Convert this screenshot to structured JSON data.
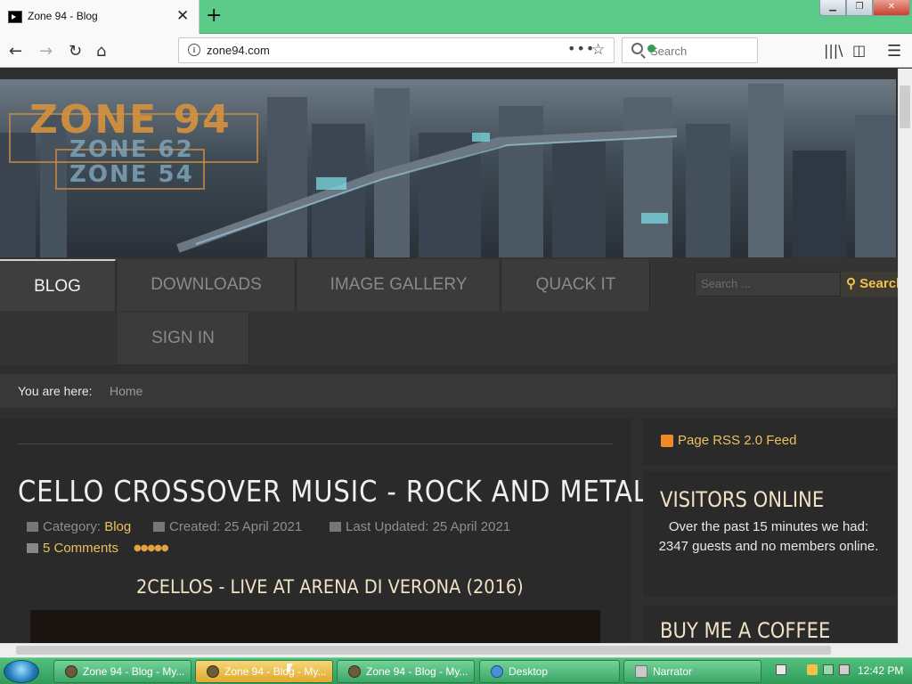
{
  "browser": {
    "tab_title": "Zone 94 - Blog",
    "url": "zone94.com",
    "search_placeholder": "Search"
  },
  "site": {
    "logo_main": "ZONE 94",
    "logo_sub_1": "ZONE 62",
    "logo_sub_2": "ZONE 54",
    "menu": [
      {
        "label": "BLOG",
        "active": true
      },
      {
        "label": "DOWNLOADS",
        "active": false
      },
      {
        "label": "IMAGE GALLERY",
        "active": false
      },
      {
        "label": "QUACK IT",
        "active": false
      },
      {
        "label": "SIGN IN",
        "active": false
      }
    ],
    "search_placeholder": "Search ...",
    "search_button": "Search",
    "breadcrumb_label": "You are here:",
    "breadcrumb_home": "Home"
  },
  "article": {
    "title": "CELLO CROSSOVER MUSIC - ROCK AND METAL",
    "category_label": "Category:",
    "category": "Blog",
    "created": "Created: 25 April 2021",
    "updated": "Last Updated: 25 April 2021",
    "comments": "5 Comments",
    "subtitle": "2CELLOS - LIVE AT ARENA DI VERONA (2016)"
  },
  "sidebar": {
    "rss": "Page RSS 2.0 Feed",
    "visitors_title": "VISITORS ONLINE",
    "visitors_text": "Over the past 15 minutes we had: 2347 guests and no members online.",
    "coffee_title": "BUY ME A COFFEE"
  },
  "taskbar": {
    "buttons": [
      {
        "label": "Zone 94 - Blog - My...",
        "active": false
      },
      {
        "label": "Zone 94 - Blog - My...",
        "active": true
      },
      {
        "label": "Zone 94 - Blog - My...",
        "active": false
      },
      {
        "label": "Desktop",
        "active": false
      },
      {
        "label": "Narrator",
        "active": false
      }
    ],
    "clock": "12:42 PM"
  },
  "colors": {
    "accent": "#e7c25e",
    "taskbar": "#3aa666",
    "background": "#2f2f2f"
  }
}
